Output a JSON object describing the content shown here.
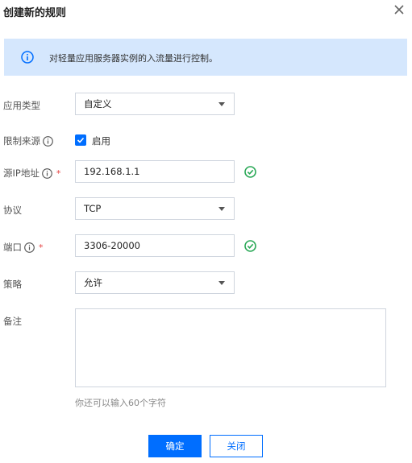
{
  "dialog": {
    "title": "创建新的规则",
    "notice": "对轻量应用服务器实例的入流量进行控制。"
  },
  "form": {
    "app_type": {
      "label": "应用类型",
      "value": "自定义"
    },
    "source_limit": {
      "label": "限制来源",
      "checkbox_label": "启用",
      "checked": true
    },
    "source_ip": {
      "label": "源IP地址",
      "required": "*",
      "value": "192.168.1.1"
    },
    "protocol": {
      "label": "协议",
      "value": "TCP"
    },
    "port": {
      "label": "端口",
      "required": "*",
      "value": "3306-20000"
    },
    "policy": {
      "label": "策略",
      "value": "允许"
    },
    "remark": {
      "label": "备注",
      "hint": "你还可以输入60个字符"
    }
  },
  "buttons": {
    "confirm": "确定",
    "cancel": "关闭"
  },
  "colors": {
    "accent": "#006eff",
    "success": "#29a856",
    "notice_bg": "#d5e7fd"
  }
}
